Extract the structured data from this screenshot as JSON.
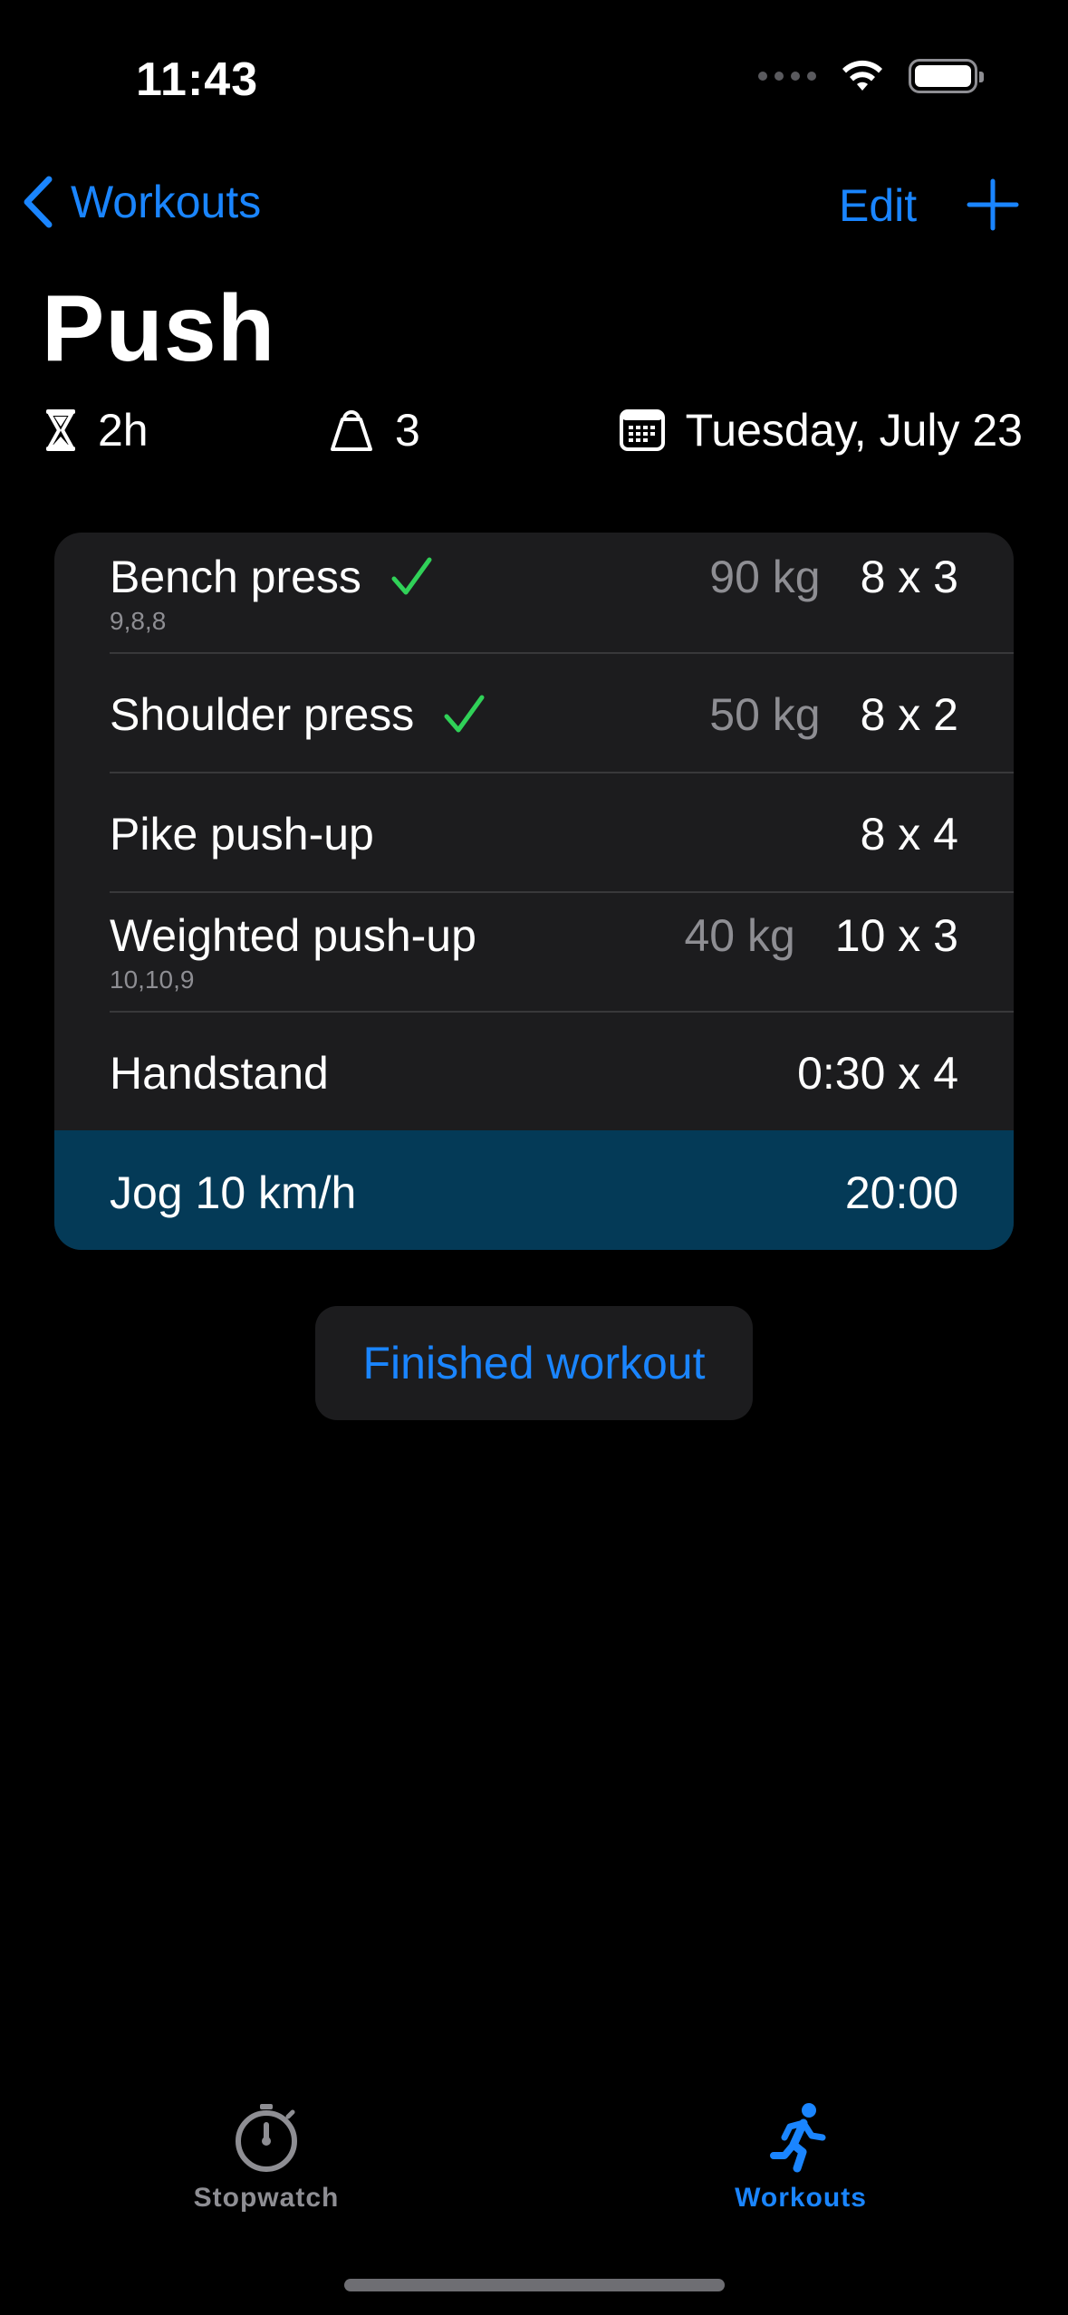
{
  "status_bar": {
    "time": "11:43"
  },
  "nav": {
    "back_label": "Workouts",
    "edit_label": "Edit"
  },
  "title": "Push",
  "summary": {
    "duration": "2h",
    "count": "3",
    "date": "Tuesday, July 23"
  },
  "exercises": [
    {
      "name": "Bench press",
      "done": true,
      "reps": "9,8,8",
      "weight": "90 kg",
      "sets": "8 x 3"
    },
    {
      "name": "Shoulder press",
      "done": true,
      "reps": "",
      "weight": "50 kg",
      "sets": "8 x 2"
    },
    {
      "name": "Pike push-up",
      "done": false,
      "reps": "",
      "weight": "",
      "sets": "8 x 4"
    },
    {
      "name": "Weighted push-up",
      "done": false,
      "reps": "10,10,9",
      "weight": "40 kg",
      "sets": "10 x 3"
    },
    {
      "name": "Handstand",
      "done": false,
      "reps": "",
      "weight": "",
      "sets": "0:30 x 4"
    },
    {
      "name": "Jog 10 km/h",
      "done": false,
      "reps": "",
      "weight": "",
      "sets": "20:00",
      "active": true
    }
  ],
  "finish_button": "Finished workout",
  "tabs": [
    {
      "label": "Stopwatch",
      "icon": "stopwatch-icon",
      "selected": false
    },
    {
      "label": "Workouts",
      "icon": "running-figure-icon",
      "selected": true
    }
  ],
  "colors": {
    "accent": "#1a85ff",
    "check": "#30d158",
    "active_row": "#043a57",
    "card": "#1c1c1e"
  }
}
